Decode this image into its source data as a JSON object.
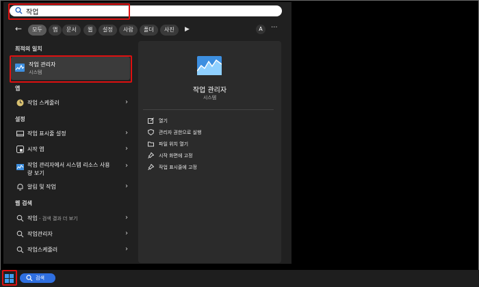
{
  "search": {
    "value": "작업"
  },
  "filters": [
    "모두",
    "앱",
    "문서",
    "웹",
    "설정",
    "사람",
    "폴더",
    "사진"
  ],
  "account_initial": "A",
  "sections": {
    "best_match": "최적의 일치",
    "apps": "앱",
    "settings": "설정",
    "web": "웹 검색"
  },
  "best": {
    "title": "작업 관리자",
    "subtitle": "시스템"
  },
  "apps": [
    {
      "label": "작업 스케줄러"
    }
  ],
  "settings": [
    {
      "label": "작업 표시줄 설정"
    },
    {
      "label": "시작 앱"
    },
    {
      "label_line1": "작업 관리자에서 시스템 리소스 사용",
      "label_line2": "량 보기"
    },
    {
      "label": "알림 및 작업"
    }
  ],
  "web": [
    {
      "label": "작업",
      "sub": " - 검색 결과 더 보기"
    },
    {
      "label": "작업관리자"
    },
    {
      "label": "작업스케줄러"
    }
  ],
  "detail": {
    "title": "작업 관리자",
    "subtitle": "시스템",
    "actions": [
      "열기",
      "관리자 권한으로 실행",
      "파일 위치 열기",
      "시작 화면에 고정",
      "작업 표시줄에 고정"
    ]
  },
  "taskbar": {
    "search_label": "검색"
  },
  "colors": {
    "highlight": "#e01010",
    "accent": "#2f6fe0"
  }
}
